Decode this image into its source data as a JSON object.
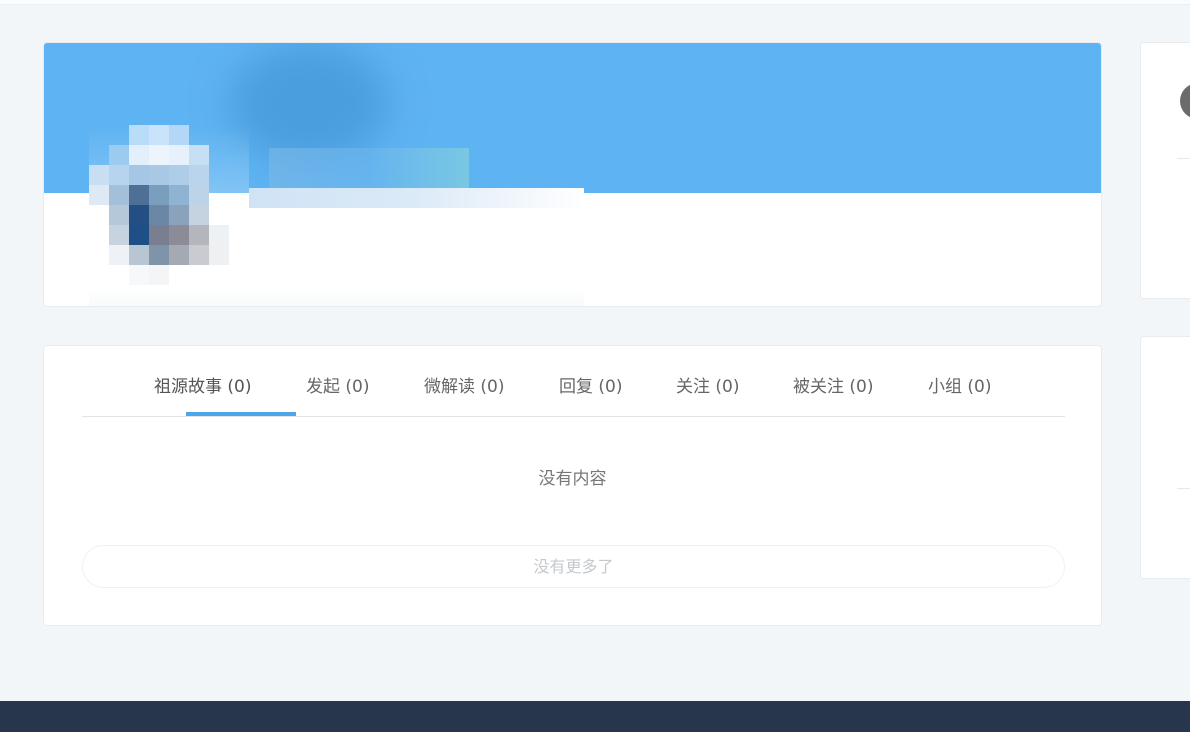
{
  "profile": {
    "cover_color": "#5eb3f2"
  },
  "tabs": [
    {
      "label": "祖源故事 (0)",
      "active": true
    },
    {
      "label": "发起 (0)",
      "active": false
    },
    {
      "label": "微解读 (0)",
      "active": false
    },
    {
      "label": "回复 (0)",
      "active": false
    },
    {
      "label": "关注 (0)",
      "active": false
    },
    {
      "label": "被关注 (0)",
      "active": false
    },
    {
      "label": "小组 (0)",
      "active": false
    }
  ],
  "content": {
    "empty_text": "没有内容",
    "more_label": "没有更多了"
  },
  "colors": {
    "accent": "#4ea6e8",
    "footer": "#27364d",
    "background": "#f3f6f9"
  }
}
